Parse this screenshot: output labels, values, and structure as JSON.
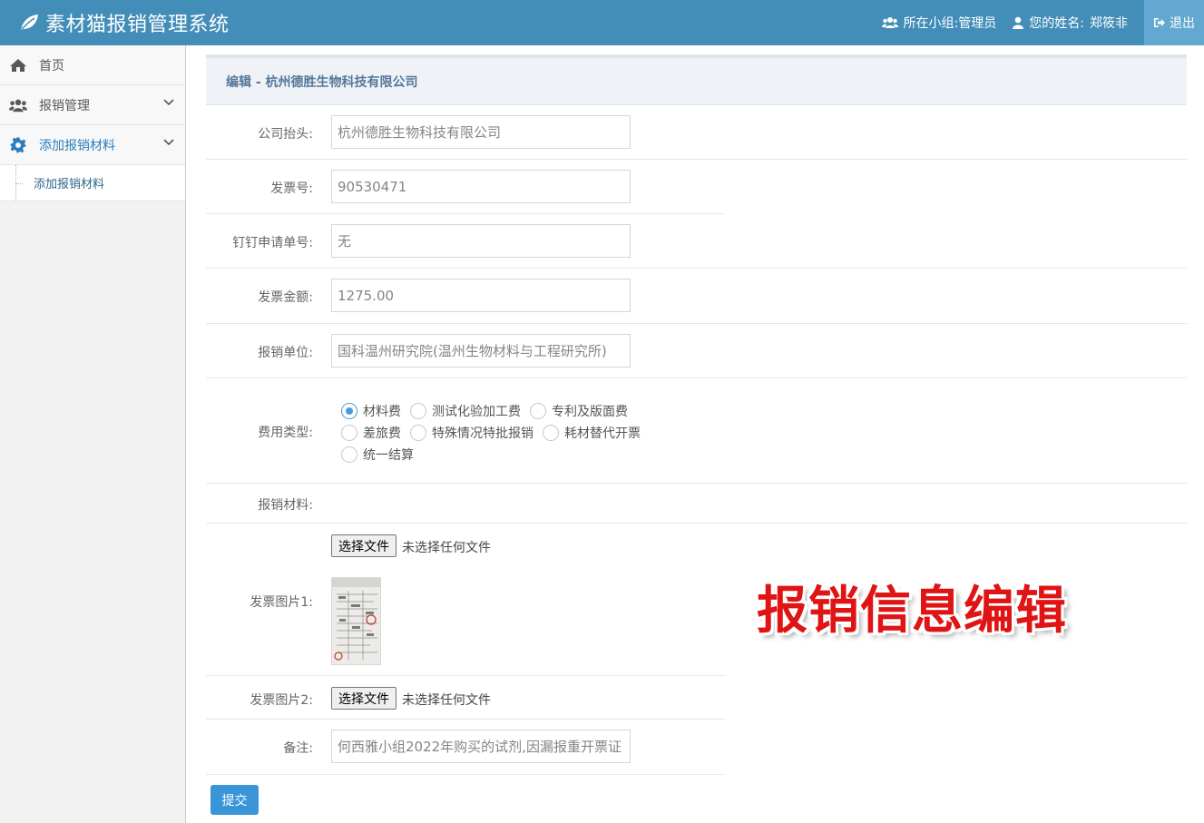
{
  "app": {
    "title": "素材猫报销管理系统"
  },
  "header": {
    "group_label": "所在小组:",
    "group_value": "管理员",
    "name_label": "您的姓名:",
    "name_value": "郑筱非",
    "logout_label": "退出"
  },
  "sidebar": {
    "items": [
      {
        "label": "首页",
        "icon": "home-icon"
      },
      {
        "label": "报销管理",
        "icon": "users-icon"
      },
      {
        "label": "添加报销材料",
        "icon": "gear-icon"
      }
    ],
    "sub_items": [
      {
        "label": "添加报销材料"
      }
    ]
  },
  "panel": {
    "title": "编辑 - 杭州德胜生物科技有限公司"
  },
  "form": {
    "company_label": "公司抬头:",
    "company_value": "杭州德胜生物科技有限公司",
    "invoice_no_label": "发票号:",
    "invoice_no_value": "90530471",
    "dingtalk_label": "钉钉申请单号:",
    "dingtalk_value": "无",
    "amount_label": "发票金额:",
    "amount_value": "1275.00",
    "unit_label": "报销单位:",
    "unit_value": "国科温州研究院(温州生物材料与工程研究所)",
    "type_label": "费用类型:",
    "types": [
      {
        "label": "材料费",
        "checked": true
      },
      {
        "label": "测试化验加工费",
        "checked": false
      },
      {
        "label": "专利及版面费",
        "checked": false
      },
      {
        "label": "差旅费",
        "checked": false
      },
      {
        "label": "特殊情况特批报销",
        "checked": false
      },
      {
        "label": "耗材替代开票",
        "checked": false
      },
      {
        "label": "统一结算",
        "checked": false
      }
    ],
    "materials_label": "报销材料:",
    "file_button_label": "选择文件",
    "file_status": "未选择任何文件",
    "invoice_img1_label": "发票图片1:",
    "invoice_img2_label": "发票图片2:",
    "remark_label": "备注:",
    "remark_value": "何西雅小组2022年购买的试剂,因漏报重开票证",
    "submit_label": "提交"
  },
  "overlay": {
    "caption": "报销信息编辑"
  },
  "colors": {
    "navbar": "#438eb9",
    "logout_bg": "#62a8d1",
    "submit": "#3a95d8",
    "overlay_text": "#e01414"
  }
}
